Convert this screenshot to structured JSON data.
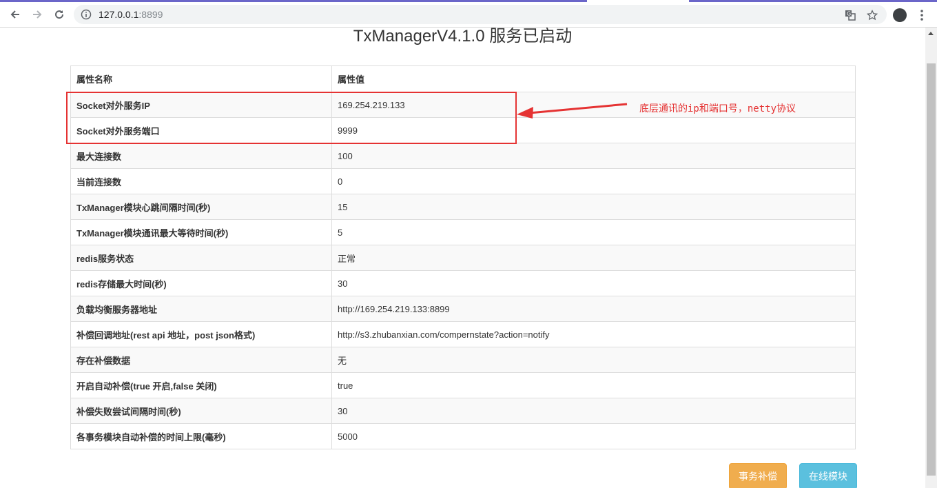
{
  "browser": {
    "url_host": "127.0.0.1",
    "url_port": ":8899",
    "accent_color": "#6b66c9"
  },
  "page": {
    "title": "TxManagerV4.1.0 服务已启动",
    "table": {
      "headers": [
        "属性名称",
        "属性值"
      ],
      "rows": [
        {
          "name": "Socket对外服务IP",
          "value": "169.254.219.133"
        },
        {
          "name": "Socket对外服务端口",
          "value": "9999"
        },
        {
          "name": "最大连接数",
          "value": "100"
        },
        {
          "name": "当前连接数",
          "value": "0"
        },
        {
          "name": "TxManager模块心跳间隔时间(秒)",
          "value": "15"
        },
        {
          "name": "TxManager模块通讯最大等待时间(秒)",
          "value": "5"
        },
        {
          "name": "redis服务状态",
          "value": "正常"
        },
        {
          "name": "redis存储最大时间(秒)",
          "value": "30"
        },
        {
          "name": "负载均衡服务器地址",
          "value": "http://169.254.219.133:8899"
        },
        {
          "name": "补偿回调地址(rest api 地址，post json格式)",
          "value": "http://s3.zhubanxian.com/compernstate?action=notify"
        },
        {
          "name": "存在补偿数据",
          "value": "无"
        },
        {
          "name": "开启自动补偿(true 开启,false 关闭)",
          "value": "true"
        },
        {
          "name": "补偿失败尝试间隔时间(秒)",
          "value": "30"
        },
        {
          "name": "各事务模块自动补偿的时间上限(毫秒)",
          "value": "5000"
        }
      ]
    },
    "annotation": {
      "text": "底层通讯的ip和端口号，netty协议",
      "color": "#e53333"
    },
    "buttons": {
      "compensate": "事务补偿",
      "online_modules": "在线模块"
    }
  }
}
